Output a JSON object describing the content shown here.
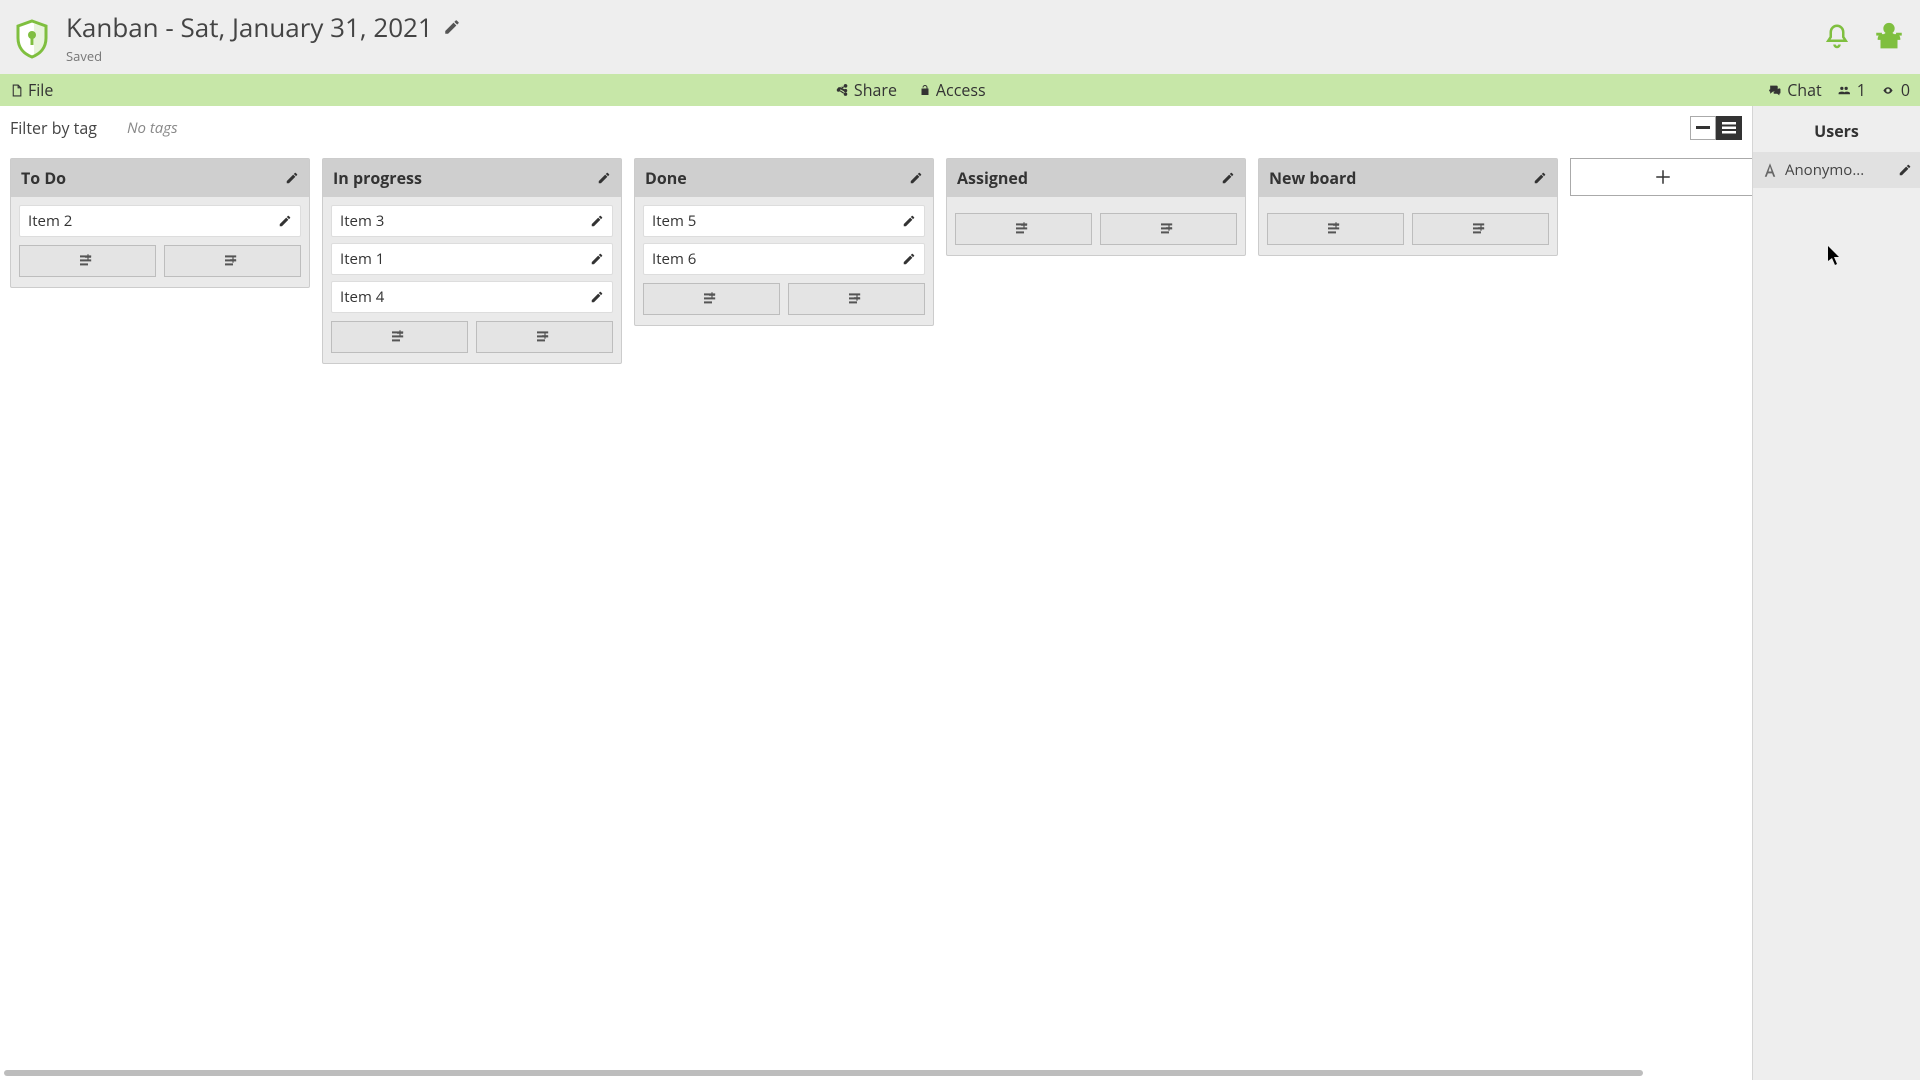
{
  "header": {
    "title": "Kanban - Sat, January 31, 2021",
    "status": "Saved"
  },
  "toolbar": {
    "file": "File",
    "share": "Share",
    "access": "Access",
    "chat": "Chat",
    "users_count": "1",
    "viewers_count": "0"
  },
  "filter": {
    "label": "Filter by tag",
    "no_tags": "No tags"
  },
  "columns": [
    {
      "title": "To Do",
      "cards": [
        "Item 2"
      ]
    },
    {
      "title": "In progress",
      "cards": [
        "Item 3",
        "Item 1",
        "Item 4"
      ]
    },
    {
      "title": "Done",
      "cards": [
        "Item 5",
        "Item 6"
      ]
    },
    {
      "title": "Assigned",
      "cards": []
    },
    {
      "title": "New board",
      "cards": []
    }
  ],
  "users_panel": {
    "title": "Users",
    "users": [
      "Anonymo..."
    ]
  },
  "colors": {
    "accent_green": "#7fbf3f",
    "toolbar_green": "#c7e7a8"
  }
}
